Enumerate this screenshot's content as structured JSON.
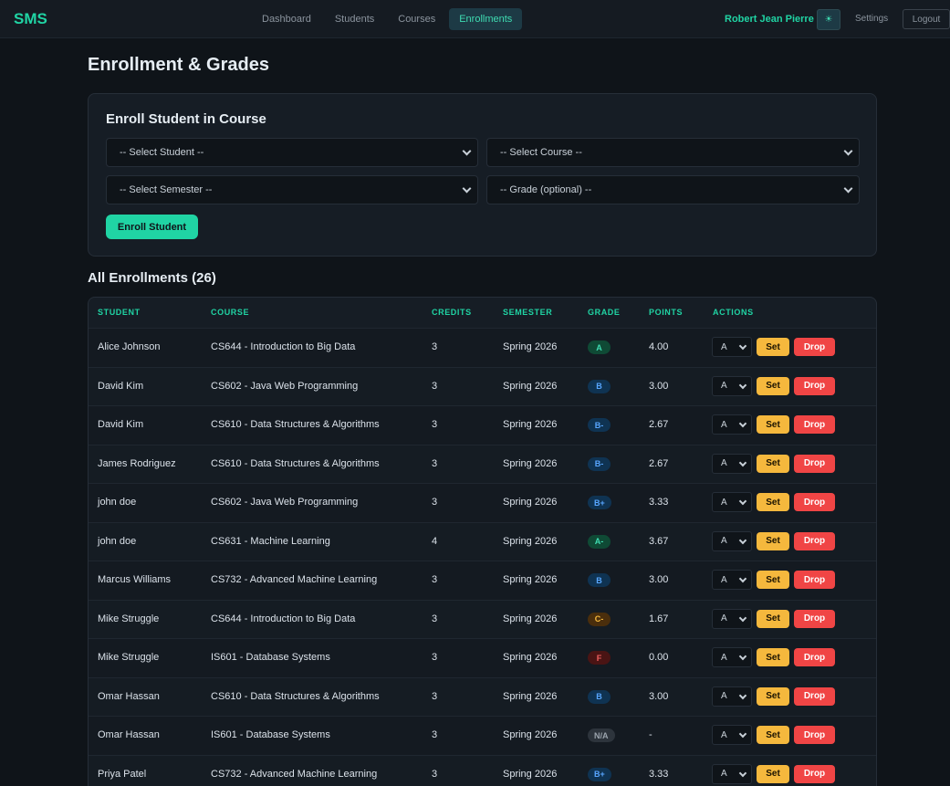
{
  "nav": {
    "brand": "SMS",
    "links": [
      {
        "label": "Dashboard",
        "active": false
      },
      {
        "label": "Students",
        "active": false
      },
      {
        "label": "Courses",
        "active": false
      },
      {
        "label": "Enrollments",
        "active": true
      }
    ],
    "user_name": "Robert Jean Pierre",
    "theme_icon": "☀",
    "settings": "Settings",
    "logout": "Logout"
  },
  "page_title": "Enrollment & Grades",
  "enroll_form": {
    "title": "Enroll Student in Course",
    "student_select": "-- Select Student --",
    "course_select": "-- Select Course --",
    "semester_select": "-- Select Semester --",
    "grade_select": "-- Grade (optional) --",
    "submit": "Enroll Student"
  },
  "list_title": "All Enrollments (26)",
  "table": {
    "columns": [
      "STUDENT",
      "COURSE",
      "CREDITS",
      "SEMESTER",
      "GRADE",
      "POINTS",
      "ACTIONS"
    ],
    "set_label": "Set",
    "drop_label": "Drop",
    "grade_option": "A",
    "rows": [
      {
        "student": "Alice Johnson",
        "course": "CS644 - Introduction to Big Data",
        "credits": "3",
        "semester": "Spring 2026",
        "grade": "A",
        "points": "4.00"
      },
      {
        "student": "David Kim",
        "course": "CS602 - Java Web Programming",
        "credits": "3",
        "semester": "Spring 2026",
        "grade": "B",
        "points": "3.00"
      },
      {
        "student": "David Kim",
        "course": "CS610 - Data Structures & Algorithms",
        "credits": "3",
        "semester": "Spring 2026",
        "grade": "B-",
        "points": "2.67"
      },
      {
        "student": "James Rodriguez",
        "course": "CS610 - Data Structures & Algorithms",
        "credits": "3",
        "semester": "Spring 2026",
        "grade": "B-",
        "points": "2.67"
      },
      {
        "student": "john doe",
        "course": "CS602 - Java Web Programming",
        "credits": "3",
        "semester": "Spring 2026",
        "grade": "B+",
        "points": "3.33"
      },
      {
        "student": "john doe",
        "course": "CS631 - Machine Learning",
        "credits": "4",
        "semester": "Spring 2026",
        "grade": "A-",
        "points": "3.67"
      },
      {
        "student": "Marcus Williams",
        "course": "CS732 - Advanced Machine Learning",
        "credits": "3",
        "semester": "Spring 2026",
        "grade": "B",
        "points": "3.00"
      },
      {
        "student": "Mike Struggle",
        "course": "CS644 - Introduction to Big Data",
        "credits": "3",
        "semester": "Spring 2026",
        "grade": "C-",
        "points": "1.67"
      },
      {
        "student": "Mike Struggle",
        "course": "IS601 - Database Systems",
        "credits": "3",
        "semester": "Spring 2026",
        "grade": "F",
        "points": "0.00"
      },
      {
        "student": "Omar Hassan",
        "course": "CS610 - Data Structures & Algorithms",
        "credits": "3",
        "semester": "Spring 2026",
        "grade": "B",
        "points": "3.00"
      },
      {
        "student": "Omar Hassan",
        "course": "IS601 - Database Systems",
        "credits": "3",
        "semester": "Spring 2026",
        "grade": "N/A",
        "points": "-"
      },
      {
        "student": "Priya Patel",
        "course": "CS732 - Advanced Machine Learning",
        "credits": "3",
        "semester": "Spring 2026",
        "grade": "B+",
        "points": "3.33"
      }
    ]
  },
  "colors": {
    "accent": "#20d4a4",
    "badge_A": {
      "bg": "#0f4a35",
      "fg": "#3fdcb2"
    },
    "badge_B": {
      "bg": "#0f3352",
      "fg": "#58a6ff"
    },
    "badge_C": {
      "bg": "#4a2e0c",
      "fg": "#f5b83d"
    },
    "badge_F": {
      "bg": "#4a1414",
      "fg": "#f06060"
    },
    "badge_NA": {
      "bg": "#2d343c",
      "fg": "#9ba4ad"
    }
  }
}
